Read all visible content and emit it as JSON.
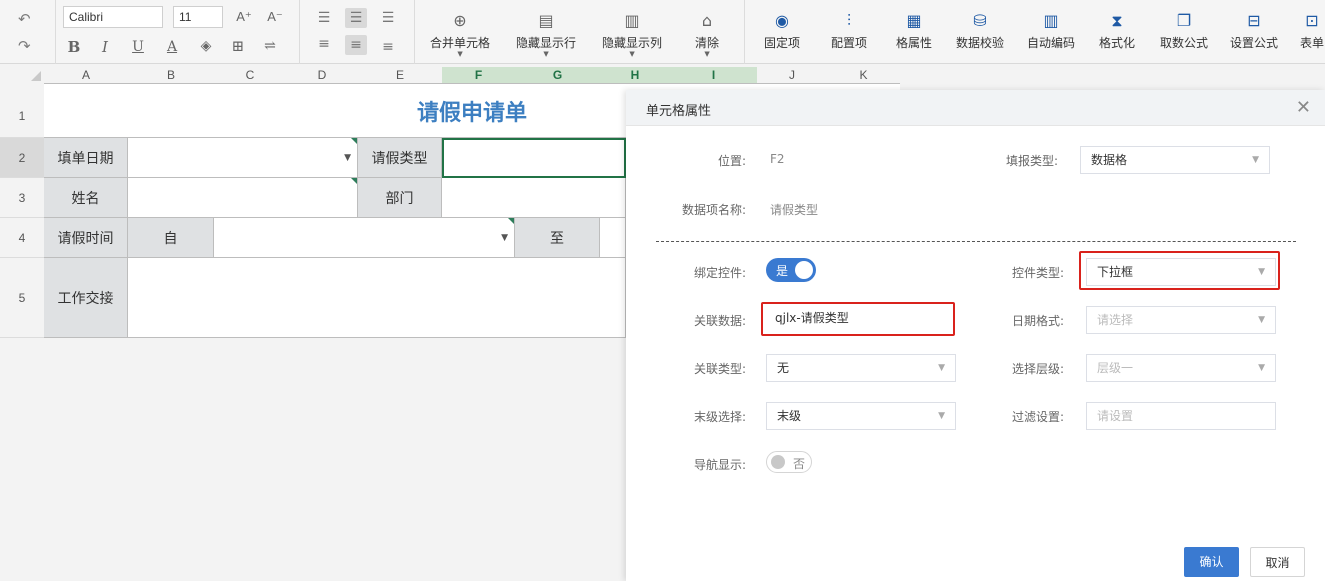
{
  "toolbar": {
    "undo_icon": "undo-icon",
    "redo_icon": "redo-icon",
    "font_name": "Calibri",
    "font_size": "11",
    "merge_label": "合并单元格",
    "hide_rows_label": "隐藏显示行",
    "hide_cols_label": "隐藏显示列",
    "clear_label": "清除",
    "fixed_label": "固定项",
    "config_label": "配置项",
    "cell_attr_label": "格属性",
    "validate_label": "数据校验",
    "autocode_label": "自动编码",
    "format_label": "格式化",
    "fetch_formula_label": "取数公式",
    "set_formula_label": "设置公式",
    "form_label": "表单"
  },
  "sheet": {
    "columns": [
      "A",
      "B",
      "C",
      "D",
      "E",
      "F",
      "G",
      "H",
      "I",
      "J",
      "K"
    ],
    "rows": [
      "1",
      "2",
      "3",
      "4",
      "5"
    ],
    "title": "请假申请单",
    "fill_date_label": "填单日期",
    "leave_type_label": "请假类型",
    "name_label": "姓名",
    "dept_label": "部门",
    "leave_time_label": "请假时间",
    "from_label": "自",
    "to_label": "至",
    "handover_label": "工作交接"
  },
  "dialog": {
    "title": "单元格属性",
    "position_label": "位置:",
    "position_value": "F2",
    "fill_type_label": "填报类型:",
    "fill_type_value": "数据格",
    "item_name_label": "数据项名称:",
    "item_name_value": "请假类型",
    "bind_label": "绑定控件:",
    "bind_value": "是",
    "control_type_label": "控件类型:",
    "control_type_value": "下拉框",
    "assoc_data_label": "关联数据:",
    "assoc_data_value": "qjlx-请假类型",
    "date_format_label": "日期格式:",
    "date_format_placeholder": "请选择",
    "assoc_type_label": "关联类型:",
    "assoc_type_value": "无",
    "select_level_label": "选择层级:",
    "select_level_placeholder": "层级一",
    "last_level_label": "末级选择:",
    "last_level_value": "末级",
    "filter_label": "过滤设置:",
    "filter_placeholder": "请设置",
    "nav_label": "导航显示:",
    "nav_value": "否",
    "ok_label": "确认",
    "cancel_label": "取消"
  },
  "colors": {
    "accent": "#3a7ad1",
    "highlight": "#d9221c",
    "title": "#3d7fc1",
    "label_bg": "#dfe1e3",
    "selected_col": "#217346"
  }
}
